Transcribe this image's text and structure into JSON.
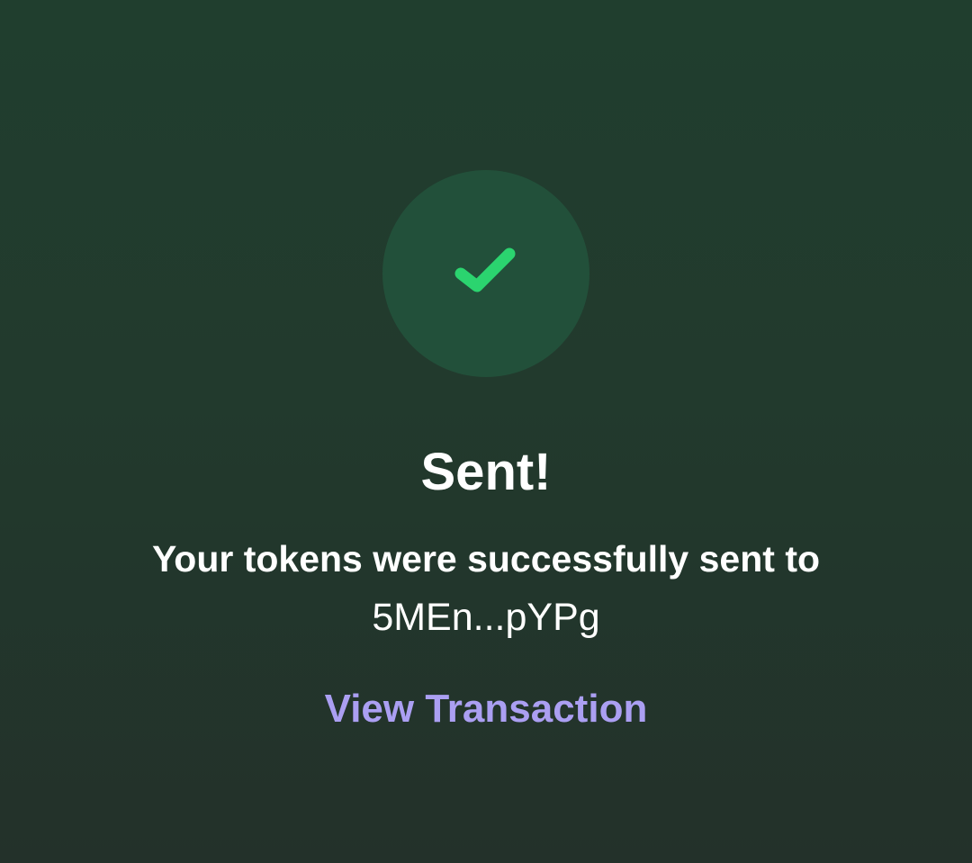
{
  "status": {
    "icon": "checkmark-icon",
    "title": "Sent!",
    "message": "Your tokens were successfully sent to",
    "recipient_address": "5MEn...pYPg"
  },
  "actions": {
    "view_transaction_label": "View Transaction"
  },
  "colors": {
    "success_green": "#2bd46f",
    "circle_background": "#22503a",
    "link_purple": "#ab9ff2",
    "background_top": "#203e2e",
    "background_bottom": "#23312a"
  }
}
